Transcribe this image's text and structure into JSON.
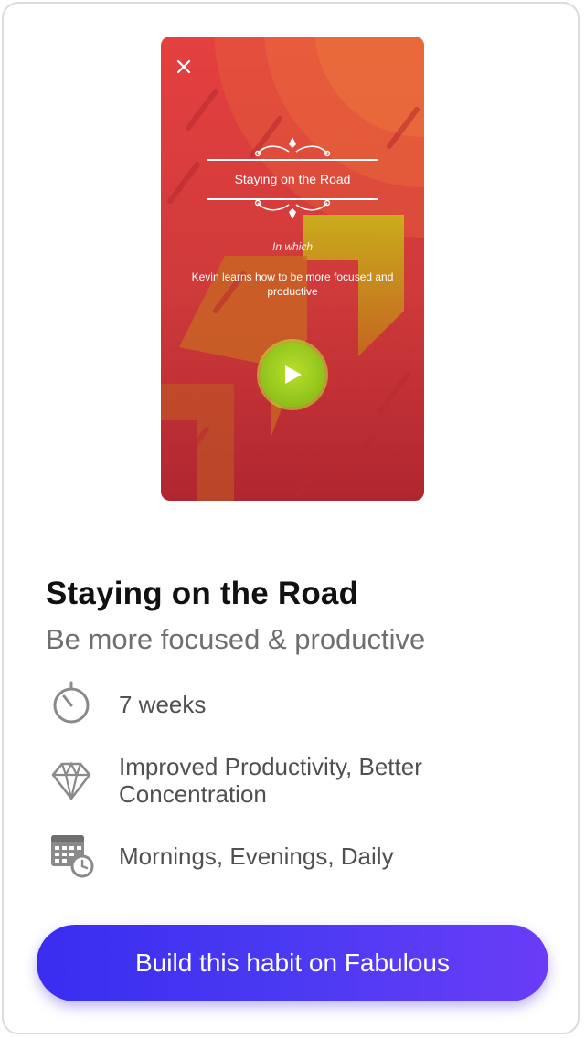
{
  "preview": {
    "close_icon": "close-icon",
    "story_title": "Staying on the Road",
    "in_which": "In which",
    "description": "Kevin learns how to be more focused and productive",
    "play_icon": "play-icon",
    "colors": {
      "top": "#e4403f",
      "bottom": "#b02630",
      "play": "#8fc01a"
    }
  },
  "habit": {
    "title": "Staying on the Road",
    "subtitle": "Be more focused & productive"
  },
  "details": [
    {
      "icon": "timer-icon",
      "text": "7 weeks"
    },
    {
      "icon": "diamond-icon",
      "text": "Improved Productivity, Better Concentration"
    },
    {
      "icon": "calendar-clock-icon",
      "text": "Mornings, Evenings, Daily"
    }
  ],
  "cta": {
    "label": "Build this habit on Fabulous",
    "color": "#3a2df0"
  }
}
